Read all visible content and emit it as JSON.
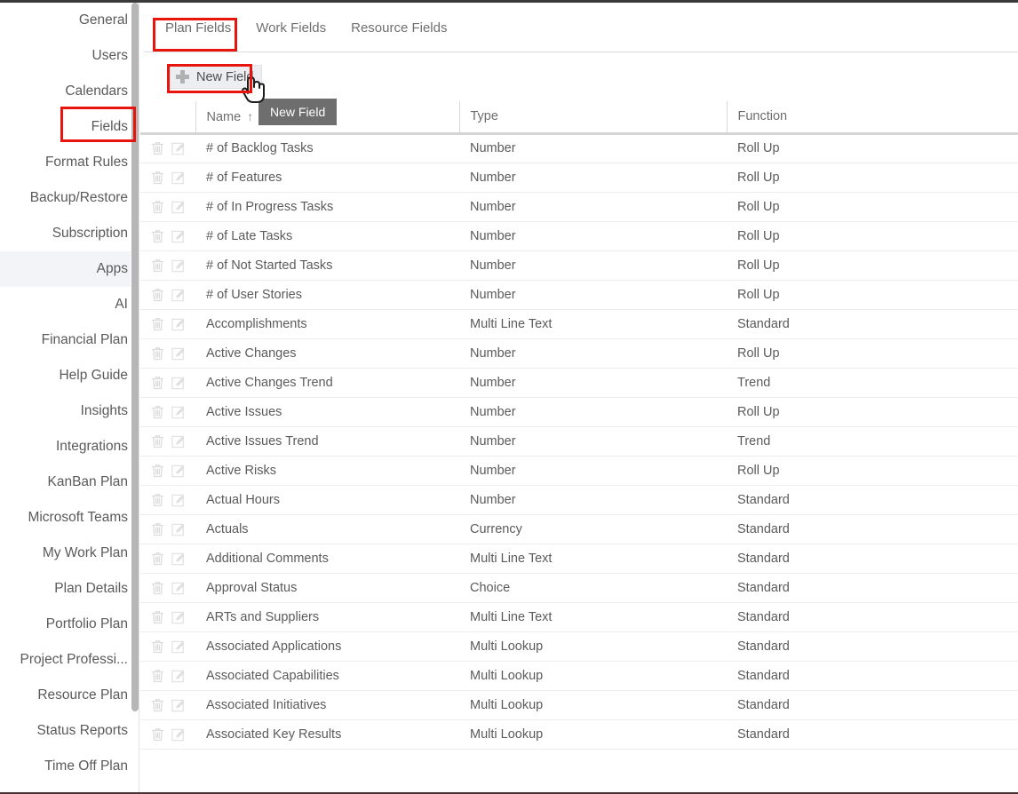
{
  "sidebar": {
    "items": [
      {
        "label": "General",
        "active": false
      },
      {
        "label": "Users",
        "active": false
      },
      {
        "label": "Calendars",
        "active": false
      },
      {
        "label": "Fields",
        "active": false
      },
      {
        "label": "Format Rules",
        "active": false
      },
      {
        "label": "Backup/Restore",
        "active": false
      },
      {
        "label": "Subscription",
        "active": false
      },
      {
        "label": "Apps",
        "active": true
      },
      {
        "label": "AI",
        "active": false
      },
      {
        "label": "Financial Plan",
        "active": false
      },
      {
        "label": "Help Guide",
        "active": false
      },
      {
        "label": "Insights",
        "active": false
      },
      {
        "label": "Integrations",
        "active": false
      },
      {
        "label": "KanBan Plan",
        "active": false
      },
      {
        "label": "Microsoft Teams",
        "active": false
      },
      {
        "label": "My Work Plan",
        "active": false
      },
      {
        "label": "Plan Details",
        "active": false
      },
      {
        "label": "Portfolio Plan",
        "active": false
      },
      {
        "label": "Project Professi...",
        "active": false
      },
      {
        "label": "Resource Plan",
        "active": false
      },
      {
        "label": "Status Reports",
        "active": false
      },
      {
        "label": "Time Off Plan",
        "active": false
      }
    ]
  },
  "tabs": [
    {
      "label": "Plan Fields",
      "active": true
    },
    {
      "label": "Work Fields",
      "active": false
    },
    {
      "label": "Resource Fields",
      "active": false
    }
  ],
  "toolbar": {
    "new_field_label": "New Field",
    "plus_icon": "plus-icon"
  },
  "tooltip": {
    "text": "New Field"
  },
  "table": {
    "columns": [
      "",
      "Name",
      "Type",
      "Function"
    ],
    "sort_column": "Name",
    "sort_arrow": "↑",
    "row_icons": [
      "delete-icon",
      "edit-icon"
    ],
    "rows": [
      {
        "name": "# of Backlog Tasks",
        "type": "Number",
        "function": "Roll Up"
      },
      {
        "name": "# of Features",
        "type": "Number",
        "function": "Roll Up"
      },
      {
        "name": "# of In Progress Tasks",
        "type": "Number",
        "function": "Roll Up"
      },
      {
        "name": "# of Late Tasks",
        "type": "Number",
        "function": "Roll Up"
      },
      {
        "name": "# of Not Started Tasks",
        "type": "Number",
        "function": "Roll Up"
      },
      {
        "name": "# of User Stories",
        "type": "Number",
        "function": "Roll Up"
      },
      {
        "name": "Accomplishments",
        "type": "Multi Line Text",
        "function": "Standard"
      },
      {
        "name": "Active Changes",
        "type": "Number",
        "function": "Roll Up"
      },
      {
        "name": "Active Changes Trend",
        "type": "Number",
        "function": "Trend"
      },
      {
        "name": "Active Issues",
        "type": "Number",
        "function": "Roll Up"
      },
      {
        "name": "Active Issues Trend",
        "type": "Number",
        "function": "Trend"
      },
      {
        "name": "Active Risks",
        "type": "Number",
        "function": "Roll Up"
      },
      {
        "name": "Actual Hours",
        "type": "Number",
        "function": "Standard"
      },
      {
        "name": "Actuals",
        "type": "Currency",
        "function": "Standard"
      },
      {
        "name": "Additional Comments",
        "type": "Multi Line Text",
        "function": "Standard"
      },
      {
        "name": "Approval Status",
        "type": "Choice",
        "function": "Standard"
      },
      {
        "name": "ARTs and Suppliers",
        "type": "Multi Line Text",
        "function": "Standard"
      },
      {
        "name": "Associated Applications",
        "type": "Multi Lookup",
        "function": "Standard"
      },
      {
        "name": "Associated Capabilities",
        "type": "Multi Lookup",
        "function": "Standard"
      },
      {
        "name": "Associated Initiatives",
        "type": "Multi Lookup",
        "function": "Standard"
      },
      {
        "name": "Associated Key Results",
        "type": "Multi Lookup",
        "function": "Standard"
      }
    ]
  },
  "highlights": {
    "color": "#e8140e",
    "targets": [
      "sidebar-item-fields",
      "tab-plan-fields",
      "new-field-button"
    ]
  }
}
